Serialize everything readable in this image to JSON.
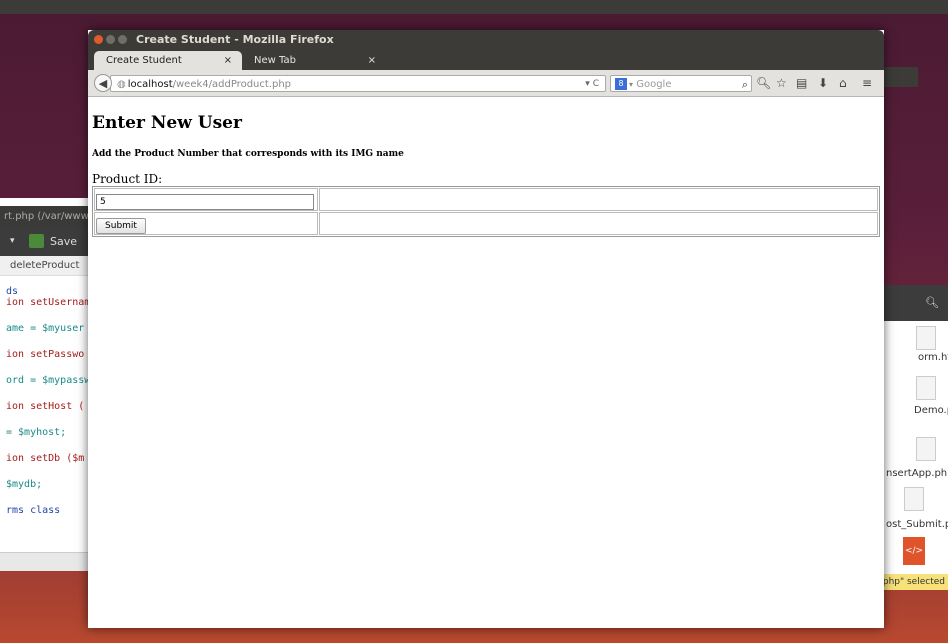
{
  "window": {
    "title": "Create Student - Mozilla Firefox"
  },
  "tabs": [
    {
      "label": "Create Student"
    },
    {
      "label": "New Tab"
    }
  ],
  "tab_close": "×",
  "new_tab_symbol": "+",
  "urlbar": {
    "host": "localhost",
    "path": "/week4/addProduct.php"
  },
  "search": {
    "engine": "8",
    "placeholder": "Google"
  },
  "page": {
    "heading": "Enter New User",
    "instruction": "Add the Product Number that corresponds with its IMG name",
    "field_label": "Product ID:",
    "product_id_value": "5",
    "submit_label": "Submit"
  },
  "background_editor": {
    "title": "rt.php (/var/www",
    "save_label": "Save",
    "tab_label": "deleteProduct",
    "code_lines": [
      "ds",
      "ion setUsernam",
      "ame = $myuser",
      "ion setPasswo",
      "ord = $mypassw",
      "ion setHost (",
      "= $myhost;",
      "ion setDb ($m",
      "$mydb;",
      "rms class"
    ]
  },
  "background_files": {
    "labels": [
      "orm.ht",
      "Demo.p",
      "nsertApp.php",
      "ost_Submit.ph"
    ],
    "selected_tip": ".php\" selected"
  },
  "colors": {
    "desktop_top": "#4a1a33",
    "desktop_bottom": "#b8492f",
    "titlebar": "#3c3b37",
    "close_btn": "#e05a2b",
    "search_engine": "#3a6fd8",
    "newtab_plus": "#7ec33a"
  },
  "icons": [
    "back-arrow-icon",
    "globe-icon",
    "dropdown-icon",
    "reload-icon",
    "search-icon",
    "star-icon",
    "bookmarks-list-icon",
    "download-icon",
    "home-icon",
    "menu-icon"
  ]
}
